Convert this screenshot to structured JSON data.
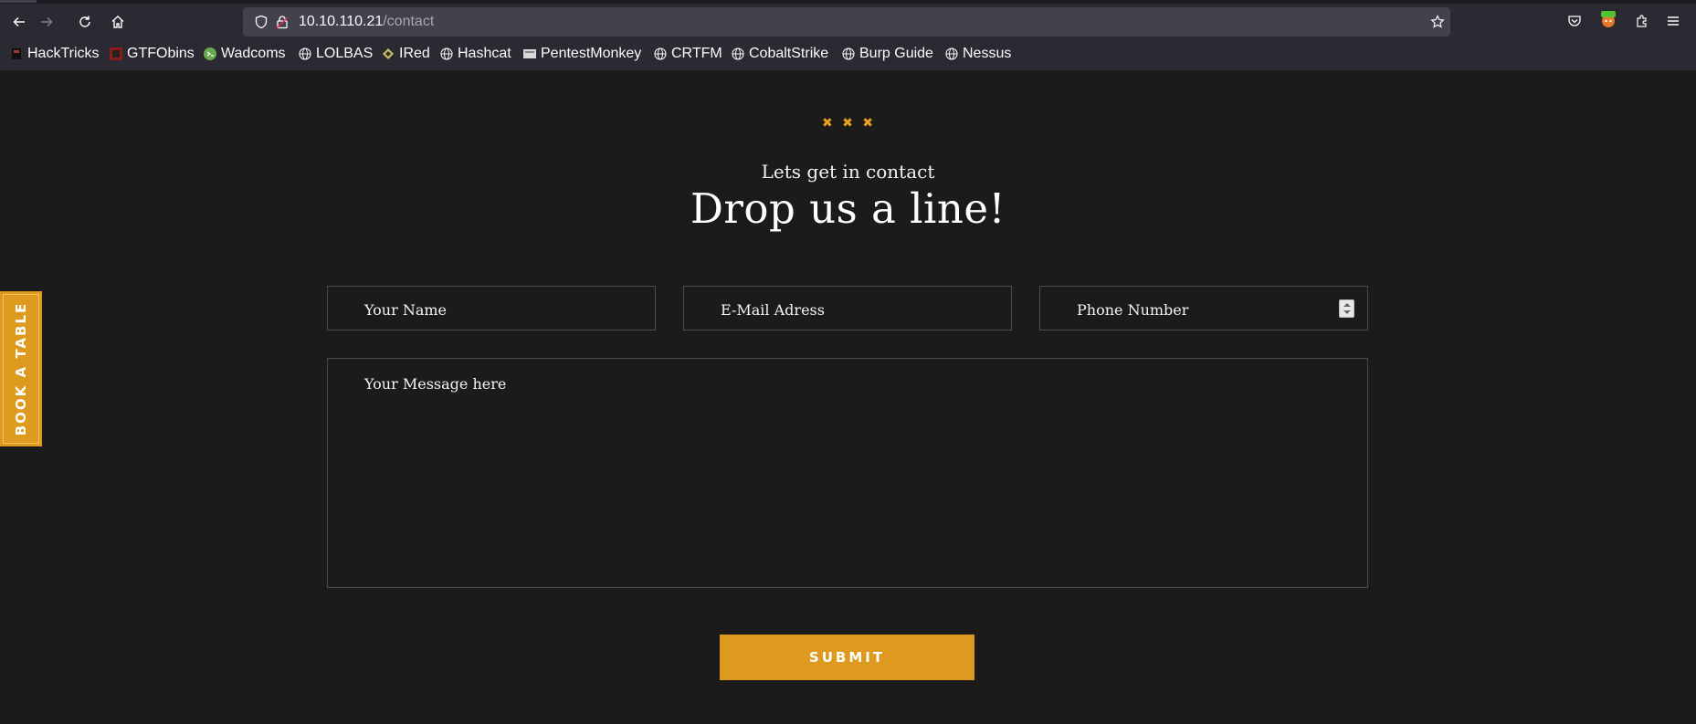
{
  "browser": {
    "url_host": "10.10.110.21",
    "url_path": "/contact",
    "bookmarks": [
      {
        "label": "HackTricks",
        "icon": "hacktricks-icon"
      },
      {
        "label": "GTFObins",
        "icon": "gtfobins-icon"
      },
      {
        "label": "Wadcoms",
        "icon": "wadcoms-icon"
      },
      {
        "label": "LOLBAS",
        "icon": "globe-icon"
      },
      {
        "label": "IRed",
        "icon": "ired-icon"
      },
      {
        "label": "Hashcat",
        "icon": "globe-icon"
      },
      {
        "label": "PentestMonkey",
        "icon": "pentestmonkey-icon"
      },
      {
        "label": "CRTFM",
        "icon": "globe-icon"
      },
      {
        "label": "CobaltStrike",
        "icon": "globe-icon"
      },
      {
        "label": "Burp Guide",
        "icon": "globe-icon"
      },
      {
        "label": "Nessus",
        "icon": "globe-icon"
      }
    ]
  },
  "page": {
    "subtitle": "Lets get in contact",
    "headline": "Drop us a line!",
    "form": {
      "name_placeholder": "Your Name",
      "email_placeholder": "E-Mail Adress",
      "phone_placeholder": "Phone Number",
      "message_placeholder": "Your Message here",
      "submit_label": "SUBMIT"
    },
    "book_tab_label": "BOOK A TABLE"
  },
  "colors": {
    "accent": "#de9a1e",
    "background": "#1b1b1b",
    "chrome": "#2b2a33"
  }
}
